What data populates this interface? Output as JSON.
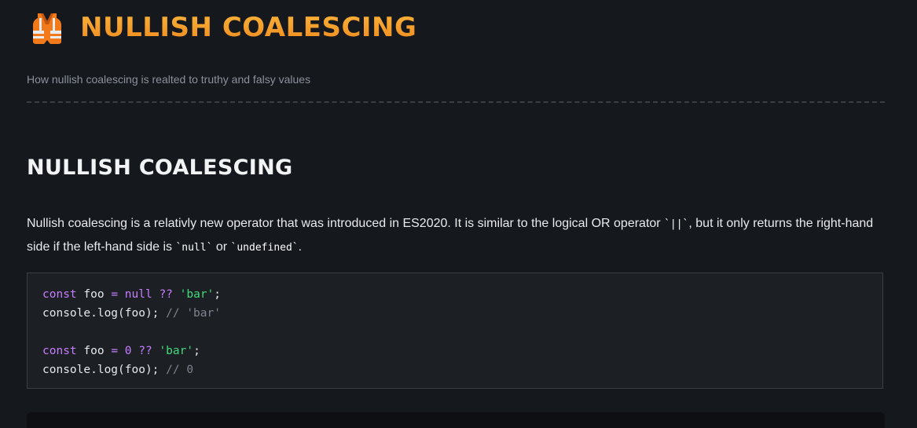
{
  "header": {
    "icon": "safety-vest-icon",
    "title": "NULLISH COALESCING",
    "subtitle": "How nullish coalescing is realted to truthy and falsy values"
  },
  "section": {
    "heading": "NULLISH COALESCING",
    "paragraph": {
      "part1": "Nullish coalescing is a relativly new operator that was introduced in ES2020. It is similar to the logical OR operator ",
      "code_or": "`||`",
      "part2": ", but it only returns the right-hand side if the left-hand side is ",
      "code_null": "`null`",
      "part3": " or ",
      "code_undefined": "`undefined`",
      "part4": "."
    }
  },
  "code": {
    "lines": [
      [
        {
          "t": "const",
          "k": "keyword"
        },
        {
          "t": " foo ",
          "k": "plain"
        },
        {
          "t": "=",
          "k": "op"
        },
        {
          "t": " ",
          "k": "plain"
        },
        {
          "t": "null",
          "k": "null"
        },
        {
          "t": " ",
          "k": "plain"
        },
        {
          "t": "??",
          "k": "op"
        },
        {
          "t": " ",
          "k": "plain"
        },
        {
          "t": "'bar'",
          "k": "string"
        },
        {
          "t": ";",
          "k": "plain"
        }
      ],
      [
        {
          "t": "console.log(foo); ",
          "k": "plain"
        },
        {
          "t": "// 'bar'",
          "k": "comment"
        }
      ],
      [],
      [
        {
          "t": "const",
          "k": "keyword"
        },
        {
          "t": " foo ",
          "k": "plain"
        },
        {
          "t": "=",
          "k": "op"
        },
        {
          "t": " ",
          "k": "plain"
        },
        {
          "t": "0",
          "k": "num"
        },
        {
          "t": " ",
          "k": "plain"
        },
        {
          "t": "??",
          "k": "op"
        },
        {
          "t": " ",
          "k": "plain"
        },
        {
          "t": "'bar'",
          "k": "string"
        },
        {
          "t": ";",
          "k": "plain"
        }
      ],
      [
        {
          "t": "console.log(foo); ",
          "k": "plain"
        },
        {
          "t": "// 0",
          "k": "comment"
        }
      ]
    ]
  },
  "colors": {
    "background": "#15181d",
    "title_accent": "#f5a02a",
    "keyword": "#c77dff",
    "string": "#3fdc7a",
    "comment": "#7d848d"
  }
}
